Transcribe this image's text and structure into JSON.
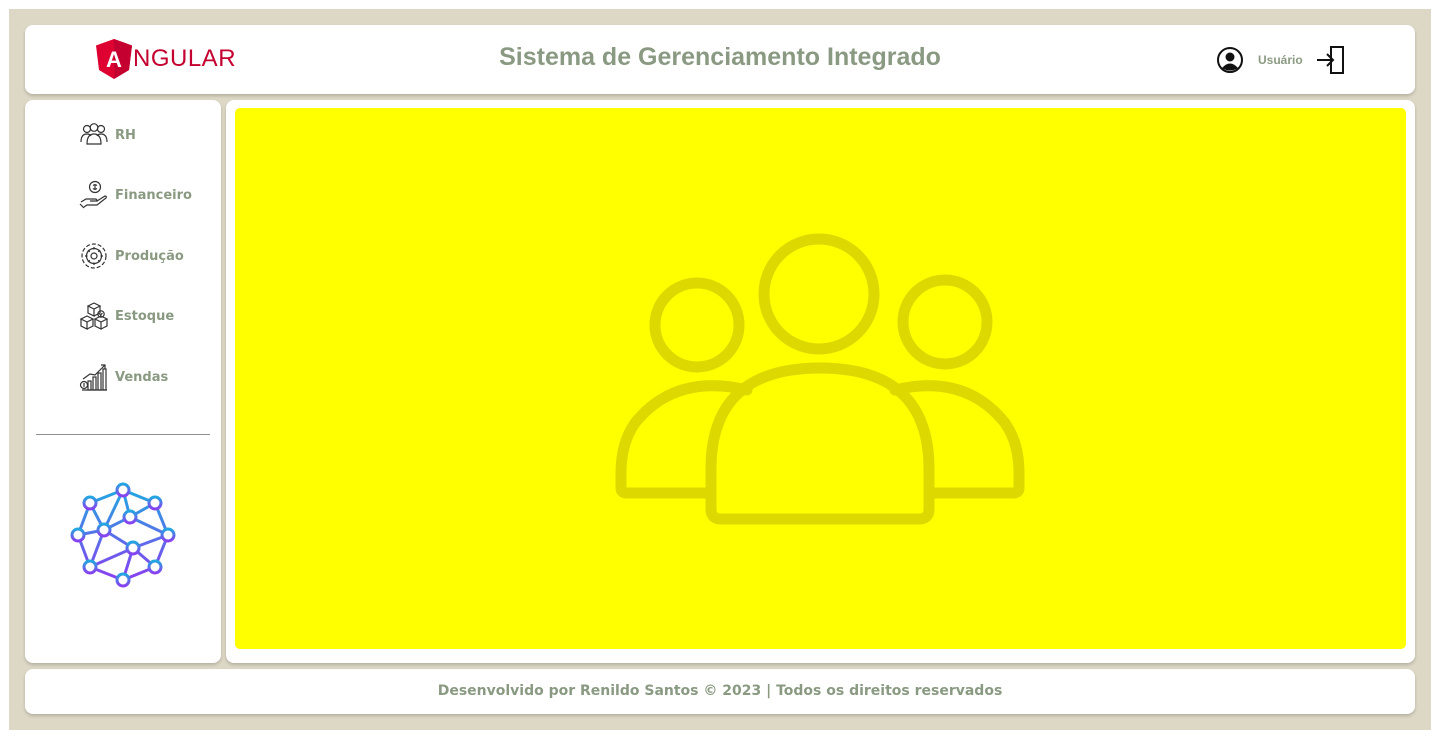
{
  "header": {
    "logo_text": "NGULAR",
    "logo_letter": "A",
    "title": "Sistema de Gerenciamento Integrado",
    "user_label": "Usuário"
  },
  "sidebar": {
    "items": [
      {
        "label": "RH",
        "icon": "people-icon"
      },
      {
        "label": "Financeiro",
        "icon": "money-hand-icon"
      },
      {
        "label": "Produção",
        "icon": "production-gear-icon"
      },
      {
        "label": "Estoque",
        "icon": "boxes-icon"
      },
      {
        "label": "Vendas",
        "icon": "sales-chart-icon"
      }
    ]
  },
  "main": {
    "panel_color": "#ffff00",
    "panel_icon": "people-group-icon"
  },
  "footer": {
    "text": "Desenvolvido por Renildo Santos © 2023 | Todos os direitos reservados"
  },
  "colors": {
    "background": "#ddd7c5",
    "accent_text": "#8a9a82",
    "angular_red": "#dd0031"
  }
}
